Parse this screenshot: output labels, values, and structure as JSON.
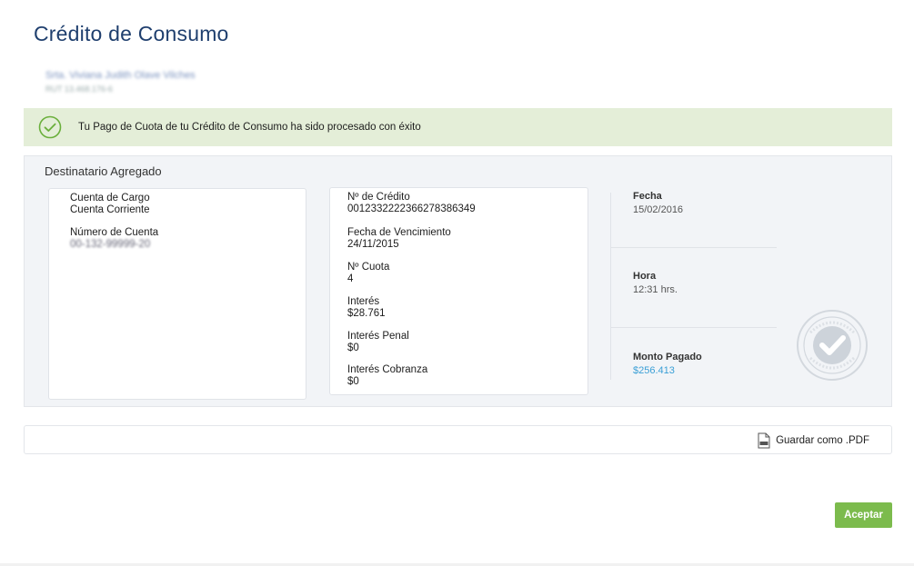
{
  "header": {
    "title": "Crédito de Consumo",
    "user_name": "Srta. Viviana Judith Olave Vilches",
    "user_rut": "RUT 13.468.176-6"
  },
  "alert": {
    "message": "Tu Pago de Cuota de tu Crédito de Consumo ha sido procesado con éxito",
    "color": "#e4eed8"
  },
  "panel": {
    "title": "Destinatario Agregado",
    "card1": {
      "cuenta_cargo_label": "Cuenta de Cargo",
      "cuenta_cargo_value": "Cuenta Corriente",
      "numero_cuenta_label": "Número de Cuenta",
      "numero_cuenta_value": "00-132-99999-20"
    },
    "card2": {
      "credito_label": "Nº de Crédito",
      "credito_value": "0012332222366278386349",
      "vencimiento_label": "Fecha de Vencimiento",
      "vencimiento_value": "24/11/2015",
      "cuota_label": "Nº Cuota",
      "cuota_value": "4",
      "interes_label": "Interés",
      "interes_value": "$28.761",
      "interes_penal_label": "Interés Penal",
      "interes_penal_value": "$0",
      "interes_cobranza_label": "Interés Cobranza",
      "interes_cobranza_value": "$0"
    },
    "summary": {
      "fecha_label": "Fecha",
      "fecha_value": "15/02/2016",
      "hora_label": "Hora",
      "hora_value": "12:31 hrs.",
      "monto_label": "Monto Pagado",
      "monto_value": "$256.413"
    }
  },
  "actions": {
    "pdf_label": "Guardar como .PDF",
    "accept_label": "Aceptar",
    "accept_color": "#7cbb4d"
  },
  "icons": {
    "success": "check-circle-icon",
    "pdf": "pdf-file-icon",
    "stamp": "approved-stamp-icon"
  }
}
